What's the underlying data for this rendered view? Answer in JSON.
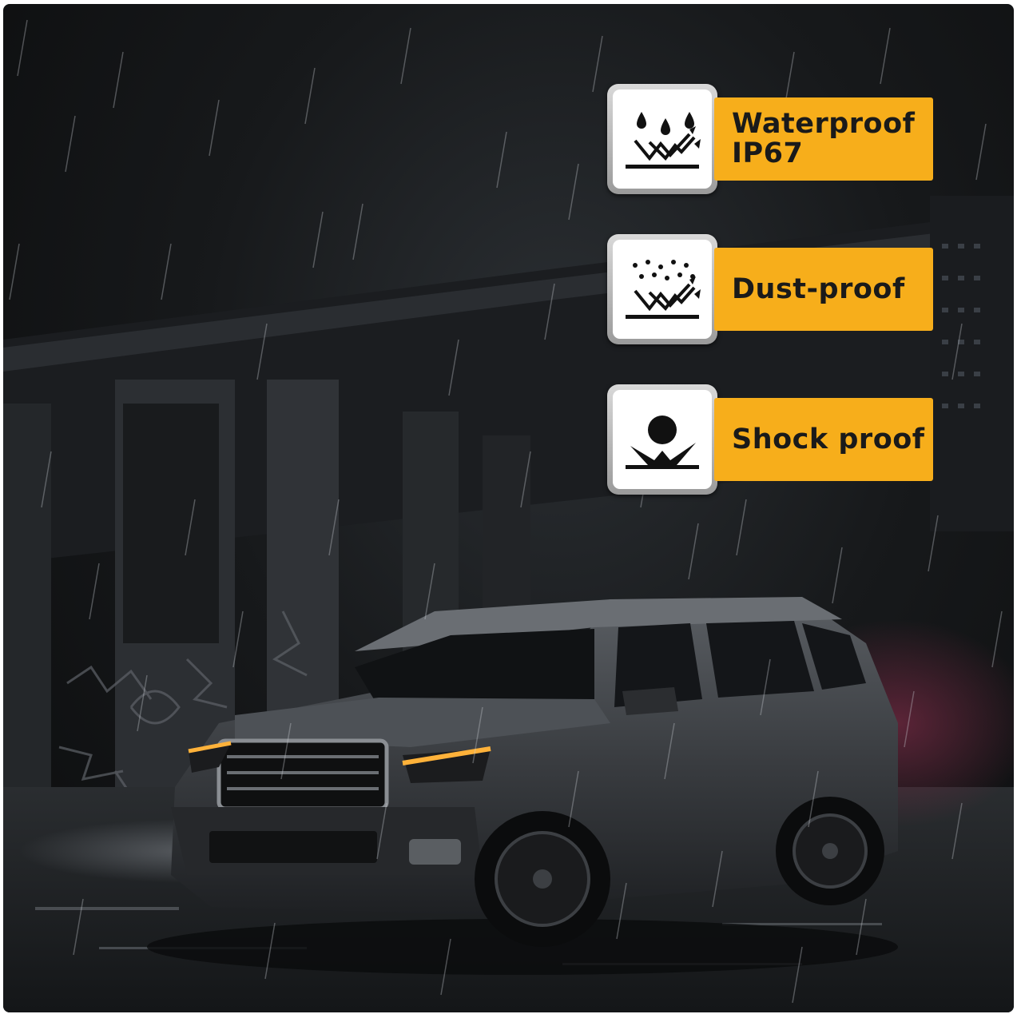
{
  "scene": {
    "description_icons": [
      "rain-streaks",
      "suv-vehicle",
      "city-underpass"
    ]
  },
  "badges": [
    {
      "icon": "waterproof-icon",
      "line1": "Waterproof",
      "line2": "IP67"
    },
    {
      "icon": "dust-proof-icon",
      "line1": "Dust-proof"
    },
    {
      "icon": "shock-proof-icon",
      "line1": "Shock proof"
    }
  ],
  "colors": {
    "label_bg": "#f7ae1b",
    "label_text": "#1a1a1a",
    "headlight_amber": "#ffb23a"
  }
}
